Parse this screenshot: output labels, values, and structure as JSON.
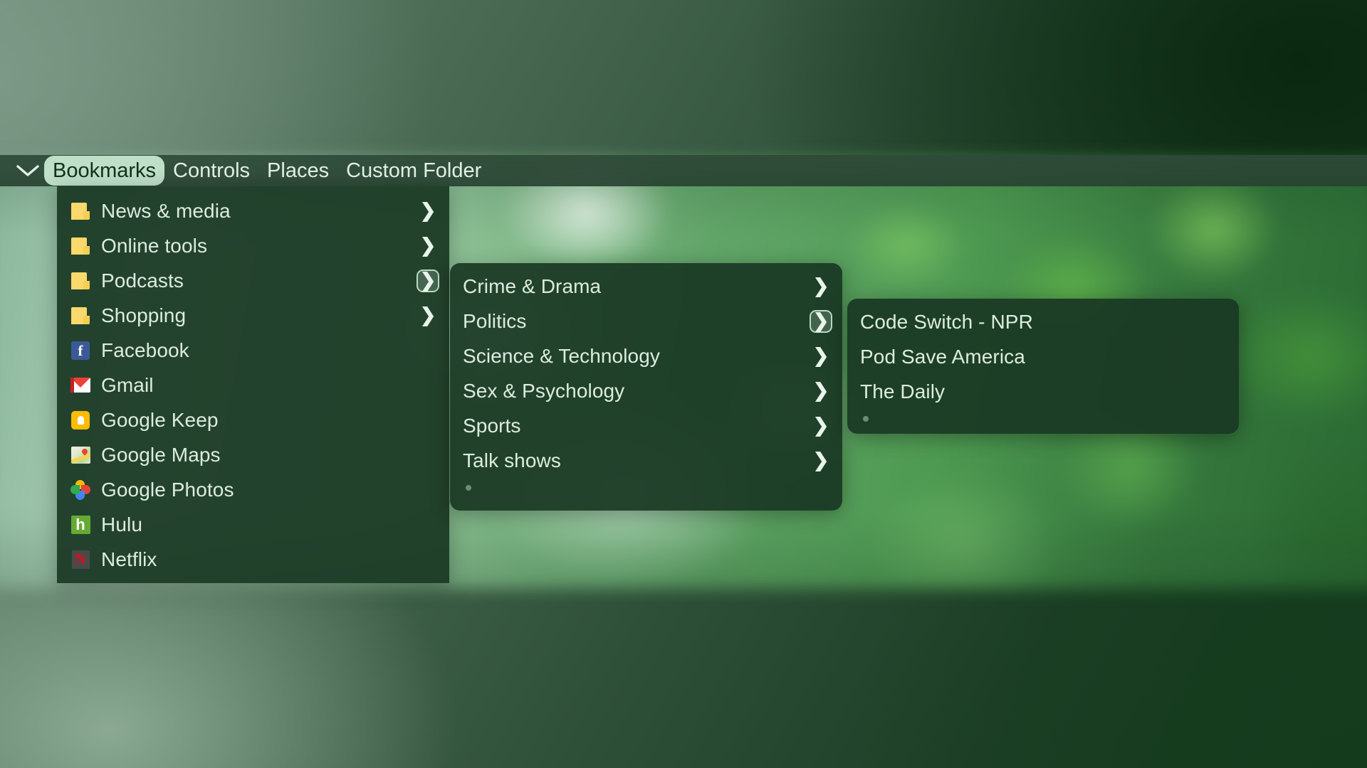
{
  "menubar": {
    "dropdown_icon": "chevron-down-icon",
    "items": [
      {
        "label": "Bookmarks",
        "active": true
      },
      {
        "label": "Controls",
        "active": false
      },
      {
        "label": "Places",
        "active": false
      },
      {
        "label": "Custom Folder",
        "active": false
      }
    ]
  },
  "panel_bookmarks": {
    "items": [
      {
        "label": "News & media",
        "icon": "folder-icon",
        "submenu": true,
        "selected": false
      },
      {
        "label": "Online tools",
        "icon": "folder-icon",
        "submenu": true,
        "selected": false
      },
      {
        "label": "Podcasts",
        "icon": "folder-icon",
        "submenu": true,
        "selected": true
      },
      {
        "label": "Shopping",
        "icon": "folder-icon",
        "submenu": true,
        "selected": false
      },
      {
        "label": "Facebook",
        "icon": "facebook-icon",
        "submenu": false,
        "selected": false
      },
      {
        "label": "Gmail",
        "icon": "gmail-icon",
        "submenu": false,
        "selected": false
      },
      {
        "label": "Google Keep",
        "icon": "google-keep-icon",
        "submenu": false,
        "selected": false
      },
      {
        "label": "Google Maps",
        "icon": "google-maps-icon",
        "submenu": false,
        "selected": false
      },
      {
        "label": "Google Photos",
        "icon": "google-photos-icon",
        "submenu": false,
        "selected": false
      },
      {
        "label": "Hulu",
        "icon": "hulu-icon",
        "submenu": false,
        "selected": false
      },
      {
        "label": "Netflix",
        "icon": "netflix-icon",
        "submenu": false,
        "selected": false
      }
    ]
  },
  "panel_podcasts": {
    "items": [
      {
        "label": "Crime & Drama",
        "submenu": true,
        "selected": false
      },
      {
        "label": "Politics",
        "submenu": true,
        "selected": true
      },
      {
        "label": "Science & Technology",
        "submenu": true,
        "selected": false
      },
      {
        "label": "Sex & Psychology",
        "submenu": true,
        "selected": false
      },
      {
        "label": "Sports",
        "submenu": true,
        "selected": false
      },
      {
        "label": "Talk shows",
        "submenu": true,
        "selected": false
      }
    ],
    "has_resize_dot": true
  },
  "panel_politics": {
    "items": [
      {
        "label": "Code Switch - NPR",
        "submenu": false,
        "selected": false
      },
      {
        "label": "Pod Save America",
        "submenu": false,
        "selected": false
      },
      {
        "label": "The Daily",
        "submenu": false,
        "selected": false
      }
    ],
    "has_resize_dot": true
  },
  "colors": {
    "accent_pill_bg": "#bfdfc9",
    "accent_pill_text": "#14301c",
    "panel_bg": "#1a3824",
    "menu_text": "#dcecdf",
    "folder_yellow": "#f9d96b",
    "wallpaper_green": "#2e4f38"
  },
  "glyphs": {
    "chevron_right": "❯",
    "chevron_down": "∨"
  }
}
